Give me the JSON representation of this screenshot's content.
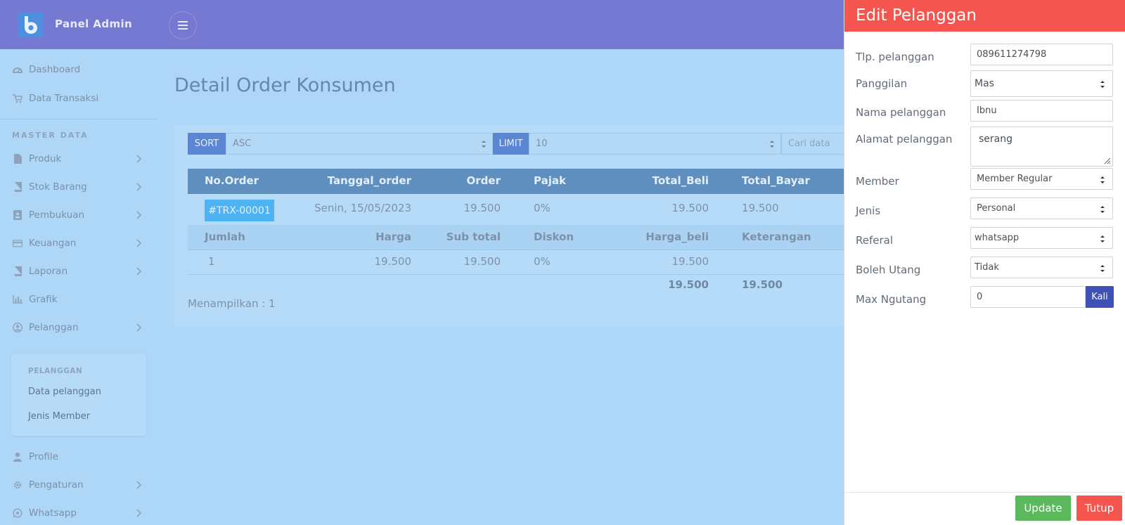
{
  "app": {
    "brand": "Panel Admin"
  },
  "sidebar": {
    "items_top": [
      {
        "label": "Dashboard",
        "icon": "dashboard-icon"
      },
      {
        "label": "Data Transaksi",
        "icon": "cart-icon"
      }
    ],
    "section_heading": "MASTER DATA",
    "items": [
      {
        "label": "Produk",
        "icon": "file-icon",
        "chevron": true
      },
      {
        "label": "Stok Barang",
        "icon": "book-icon",
        "chevron": true
      },
      {
        "label": "Pembukuan",
        "icon": "contact-book-icon",
        "chevron": true
      },
      {
        "label": "Keuangan",
        "icon": "credit-card-icon",
        "chevron": true
      },
      {
        "label": "Laporan",
        "icon": "book-icon",
        "chevron": true
      },
      {
        "label": "Grafik",
        "icon": "bar-chart-icon",
        "chevron": false
      },
      {
        "label": "Pelanggan",
        "icon": "user-circle-icon",
        "chevron": true
      }
    ],
    "submenu": {
      "heading": "PELANGGAN",
      "items": [
        "Data pelanggan",
        "Jenis Member"
      ]
    },
    "items_bottom": [
      {
        "label": "Profile",
        "icon": "user-icon",
        "chevron": false
      },
      {
        "label": "Pengaturan",
        "icon": "gear-icon",
        "chevron": true
      },
      {
        "label": "Whatsapp",
        "icon": "whatsapp-icon",
        "chevron": true
      }
    ]
  },
  "main": {
    "title": "Detail Order Konsumen",
    "controls": {
      "sort_label": "SORT",
      "sort_value": "ASC",
      "limit_label": "LIMIT",
      "limit_value": "10",
      "search_placeholder": "Cari data"
    },
    "table": {
      "headers": [
        "No.Order",
        "Tanggal_order",
        "Order",
        "Pajak",
        "Total_Beli",
        "Total_Bayar"
      ],
      "row": {
        "no_order": "#TRX-00001",
        "tanggal": "Senin, 15/05/2023",
        "order": "19.500",
        "pajak": "0%",
        "total_beli": "19.500",
        "total_bayar": "19.500"
      },
      "sub_headers": [
        "Jumlah",
        "Harga",
        "Sub total",
        "Diskon",
        "Harga_beli",
        "Keterangan"
      ],
      "sub_row": {
        "jumlah": "1",
        "harga": "19.500",
        "sub_total": "19.500",
        "diskon": "0%",
        "harga_beli": "19.500",
        "keterangan": ""
      },
      "totals": {
        "total_beli": "19.500",
        "total_bayar": "19.500"
      }
    },
    "showing": "Menampilkan : 1"
  },
  "panel": {
    "title": "Edit Pelanggan",
    "fields": {
      "tlp": {
        "label": "Tlp. pelanggan",
        "value": "089611274798"
      },
      "panggilan": {
        "label": "Panggilan",
        "value": "Mas"
      },
      "nama": {
        "label": "Nama pelanggan",
        "value": "Ibnu"
      },
      "alamat": {
        "label": "Alamat pelanggan",
        "value": "serang"
      },
      "member": {
        "label": "Member",
        "value": "Member Regular"
      },
      "jenis": {
        "label": "Jenis",
        "value": "Personal"
      },
      "referal": {
        "label": "Referal",
        "value": "whatsapp"
      },
      "utang": {
        "label": "Boleh Utang",
        "value": "Tidak"
      },
      "max": {
        "label": "Max Ngutang",
        "value": "0",
        "addon": "Kali"
      }
    },
    "buttons": {
      "update": "Update",
      "tutup": "Tutup"
    }
  },
  "colors": {
    "header": "#7679d1",
    "overlay": "#aed7f7",
    "panel_header": "#f4564f",
    "accent_blue": "#5a86d4",
    "update": "#5cb85c",
    "addon": "#3f51b5"
  }
}
